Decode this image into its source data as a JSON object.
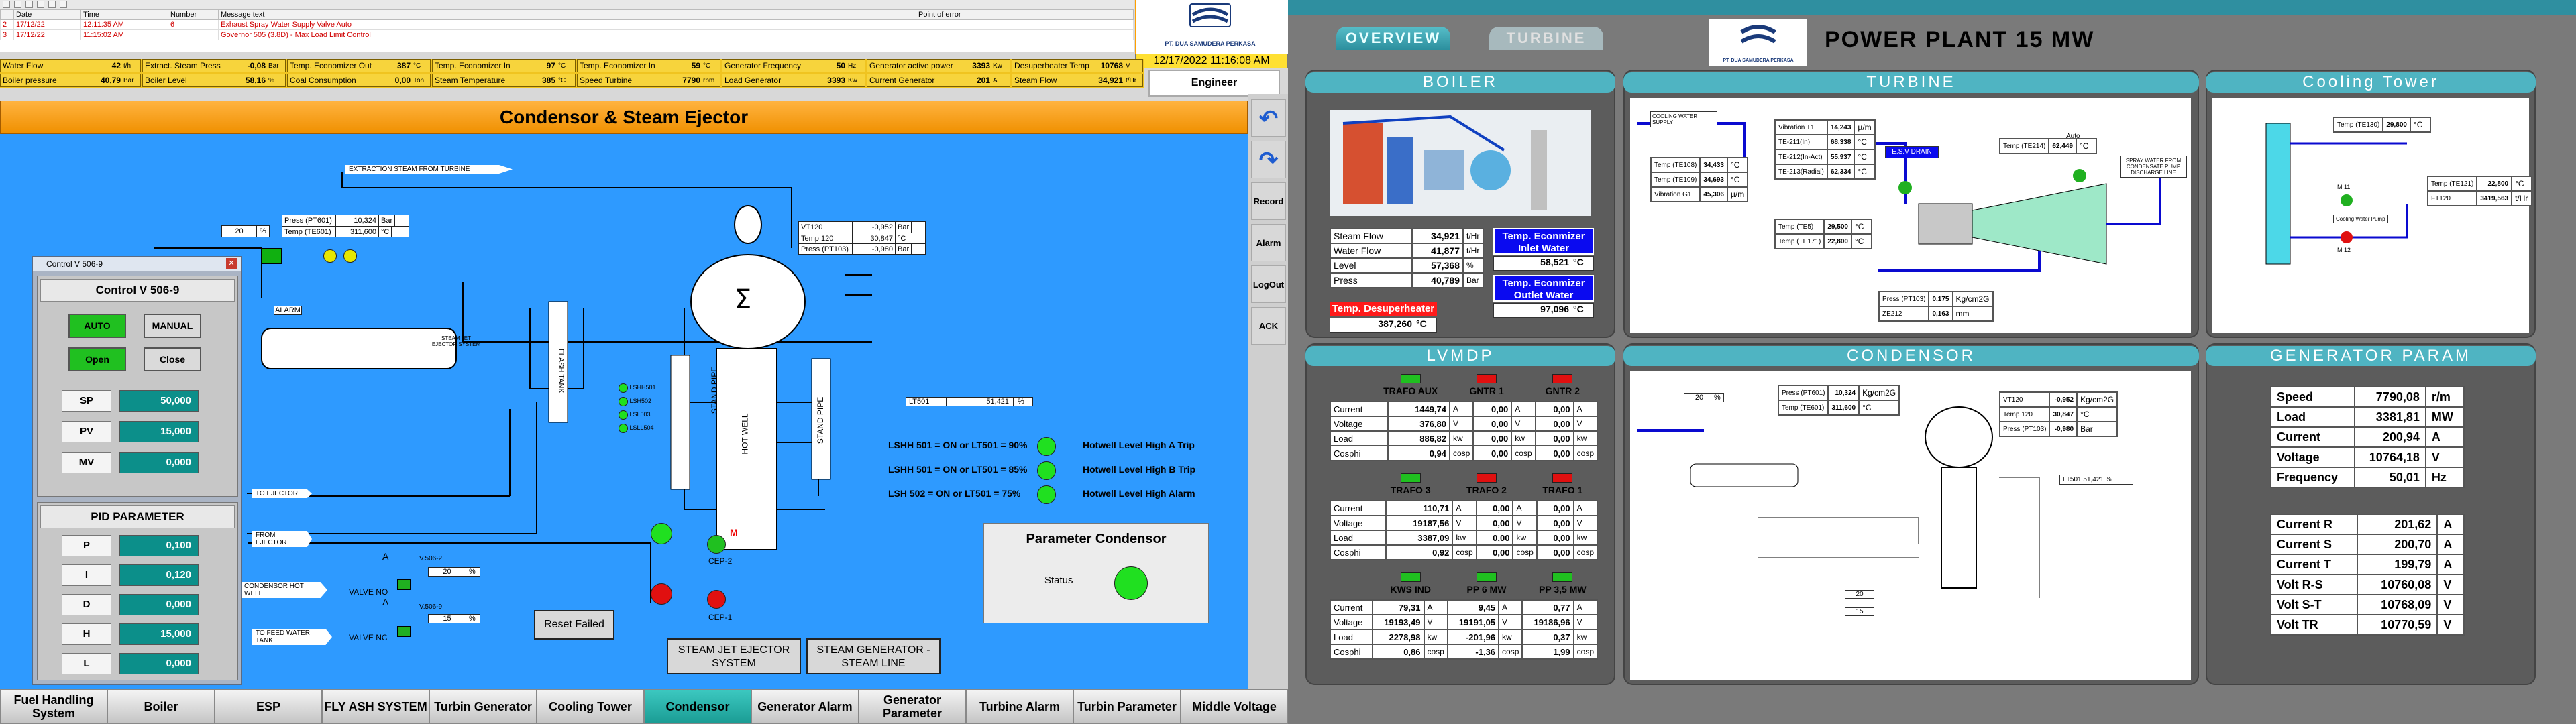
{
  "alarms": {
    "headers": [
      "Date",
      "Time",
      "Number",
      "Message text",
      "Point of error"
    ],
    "rows": [
      {
        "idx": "2",
        "date": "17/12/22",
        "time": "12:11:35 AM",
        "number": "6",
        "message": "Exhaust Spray Water Supply Valve Auto"
      },
      {
        "idx": "3",
        "date": "17/12/22",
        "time": "11:15:02 AM",
        "number": "",
        "message": "Governor 505 (3.8D) - Max Load Limit Control"
      }
    ]
  },
  "header": {
    "company": "PT. DUA SAMUDERA PERKASA",
    "datetime": "12/17/2022 11:16:08 AM",
    "user": "Engineer"
  },
  "status": [
    {
      "label": "Water Flow",
      "value": "42",
      "unit": "t/h"
    },
    {
      "label": "Extract. Steam Press",
      "value": "-0,08",
      "unit": "Bar"
    },
    {
      "label": "Temp. Economizer Out",
      "value": "387",
      "unit": "°C"
    },
    {
      "label": "Temp. Economizer In",
      "value": "97",
      "unit": "°C"
    },
    {
      "label": "Temp. Economizer In",
      "value": "59",
      "unit": "°C"
    },
    {
      "label": "Generator Frequency",
      "value": "50",
      "unit": "Hz"
    },
    {
      "label": "Generator active power",
      "value": "3393",
      "unit": "Kw"
    },
    {
      "label": "Desuperheater Temp",
      "value": "10768",
      "unit": "V"
    },
    {
      "label": "Boiler pressure",
      "value": "40,79",
      "unit": "Bar"
    },
    {
      "label": "Boiler Level",
      "value": "58,16",
      "unit": "%"
    },
    {
      "label": "Coal Consumption",
      "value": "0,00",
      "unit": "Ton"
    },
    {
      "label": "Steam Temperature",
      "value": "385",
      "unit": "°C"
    },
    {
      "label": "Speed Turbine",
      "value": "7790",
      "unit": "rpm"
    },
    {
      "label": "Load Generator",
      "value": "3393",
      "unit": "Kw"
    },
    {
      "label": "Current Generator",
      "value": "201",
      "unit": "A"
    },
    {
      "label": "Voltage Generator",
      "value": "10768",
      "unit": "V"
    },
    {
      "label": "Steam Flow",
      "value": "34,921",
      "unit": "t/Hr"
    }
  ],
  "page_title": "Condensor & Steam Ejector",
  "sidebar": [
    "Record",
    "Alarm",
    "LogOut",
    "ACK"
  ],
  "nav": [
    "Fuel Handling System",
    "Boiler",
    "ESP",
    "FLY ASH SYSTEM",
    "Turbin Generator",
    "Cooling Tower",
    "Condensor",
    "Generator Alarm",
    "Generator Parameter",
    "Turbine Alarm",
    "Turbin Parameter",
    "Middle Voltage"
  ],
  "nav_active": "Condensor",
  "control": {
    "window_title": "Control V 506-9",
    "heading": "Control V 506-9",
    "auto": "AUTO",
    "manual": "MANUAL",
    "open": "Open",
    "close": "Close",
    "values": [
      {
        "k": "SP",
        "v": "50,000"
      },
      {
        "k": "PV",
        "v": "15,000"
      },
      {
        "k": "MV",
        "v": "0,000"
      }
    ],
    "pid_heading": "PID PARAMETER",
    "pid": [
      {
        "k": "P",
        "v": "0,100"
      },
      {
        "k": "I",
        "v": "0,120"
      },
      {
        "k": "D",
        "v": "0,000"
      },
      {
        "k": "H",
        "v": "15,000"
      },
      {
        "k": "L",
        "v": "0,000"
      }
    ]
  },
  "diagram": {
    "extraction": "EXTRACTION STEAM FROM TURBINE",
    "valve_pct": "20",
    "pct": "%",
    "ejector_table": [
      [
        "Press (PT601)",
        "10,324",
        "Bar"
      ],
      [
        "Temp (TE601)",
        "311,600",
        "°C"
      ]
    ],
    "alarm": "ALARM",
    "ejector_label": "STEAM JET EJECTOR SYSTEM",
    "flash_tank": "FLASH TANK",
    "stand_pipe": "STAND PIPE",
    "hot_well": "HOT WELL",
    "vt_table": [
      [
        "VT120",
        "-0,952",
        "Bar"
      ],
      [
        "Temp 120",
        "30,847",
        "°C"
      ],
      [
        "Press (PT103)",
        "-0,980",
        "Bar"
      ]
    ],
    "level_leds": [
      "LSHH501",
      "LSH502",
      "LSL503",
      "LSLL504"
    ],
    "lt501": {
      "label": "LT501",
      "value": "51,421",
      "unit": "%"
    },
    "rules": [
      {
        "cond": "LSHH 501 = ON or LT501 = 90%",
        "text": "Hotwell Level High A Trip"
      },
      {
        "cond": "LSHH 501 = ON or LT501 = 85%",
        "text": "Hotwell Level High B Trip"
      },
      {
        "cond": "LSH 502   = ON or LT501 = 75%",
        "text": "Hotwell Level High Alarm"
      }
    ],
    "to_ejector": "TO EJECTOR",
    "from_ejector": "FROM EJECTOR",
    "cond_hot_well": "CONDENSOR HOT WELL",
    "feed_water": "TO FEED WATER TANK",
    "valve_no": {
      "name": "VALVE NO",
      "id": "V.506-2",
      "value": "20"
    },
    "valve_nc": {
      "name": "VALVE NC",
      "id": "V.506-9",
      "value": "15"
    },
    "cep2": "CEP-2",
    "cep1": "CEP-1",
    "m": "M",
    "a": "A",
    "reset": "Reset Failed",
    "param_title": "Parameter Condensor",
    "status": "Status",
    "btn_ejector": "STEAM JET EJECTOR SYSTEM",
    "btn_generator": "STEAM GENERATOR - STEAM LINE"
  },
  "right": {
    "tabs": [
      "OVERVIEW",
      "TURBINE"
    ],
    "title": "POWER PLANT 15 MW",
    "company": "PT. DUA SAMUDERA PERKASA",
    "boiler": {
      "title": "BOILER",
      "rows": [
        [
          "Steam Flow",
          "34,921",
          "t/Hr"
        ],
        [
          "Water Flow",
          "41,877",
          "t/Hr"
        ],
        [
          "Level",
          "57,368",
          "%"
        ],
        [
          "Press",
          "40,789",
          "Bar"
        ]
      ],
      "eco_in_label": "Temp. Econmizer Inlet Water",
      "eco_in": "58,521",
      "eco_out_label": "Temp. Econmizer Outlet Water",
      "eco_out": "97,096",
      "desup_label": "Temp. Desuperheater",
      "desup": "387,260",
      "degc": "°C"
    },
    "lvmdp": {
      "title": "LVMDP",
      "groups": [
        {
          "heads": [
            "TRAFO AUX",
            "GNTR  1",
            "GNTR  2"
          ],
          "leds": [
            "#20c020",
            "#e01010",
            "#e01010"
          ],
          "rows": [
            [
              "Current",
              "1449,74",
              "A",
              "0,00",
              "A",
              "0,00",
              "A"
            ],
            [
              "Voltage",
              "376,80",
              "V",
              "0,00",
              "V",
              "0,00",
              "V"
            ],
            [
              "Load",
              "886,82",
              "kw",
              "0,00",
              "kw",
              "0,00",
              "kw"
            ],
            [
              "Cosphi",
              "0,94",
              "cosp",
              "0,00",
              "cosp",
              "0,00",
              "cosp"
            ]
          ]
        },
        {
          "heads": [
            "TRAFO 3",
            "TRAFO 2",
            "TRAFO 1"
          ],
          "leds": [
            "#20c020",
            "#e01010",
            "#e01010"
          ],
          "rows": [
            [
              "Current",
              "110,71",
              "A",
              "0,00",
              "A",
              "0,00",
              "A"
            ],
            [
              "Voltage",
              "19187,56",
              "V",
              "0,00",
              "V",
              "0,00",
              "V"
            ],
            [
              "Load",
              "3387,09",
              "kw",
              "0,00",
              "kw",
              "0,00",
              "kw"
            ],
            [
              "Cosphi",
              "0,92",
              "cosp",
              "0,00",
              "cosp",
              "0,00",
              "cosp"
            ]
          ]
        },
        {
          "heads": [
            "KWS IND",
            "PP 6 MW",
            "PP 3,5 MW"
          ],
          "leds": [
            "#20c020",
            "#20c020",
            "#20c020"
          ],
          "rows": [
            [
              "Current",
              "79,31",
              "A",
              "9,45",
              "A",
              "0,77",
              "A"
            ],
            [
              "Voltage",
              "19193,49",
              "V",
              "19191,05",
              "V",
              "19186,96",
              "V"
            ],
            [
              "Load",
              "2278,98",
              "kw",
              "-201,96",
              "kw",
              "0,37",
              "kw"
            ],
            [
              "Cosphi",
              "0,86",
              "cosp",
              "-1,36",
              "cosp",
              "1,99",
              "cosp"
            ]
          ]
        }
      ]
    },
    "turbine": {
      "title": "TURBINE",
      "vib": [
        [
          "Vibration T1",
          "14,243",
          "µ/m"
        ],
        [
          "TE-211(In)",
          "68,338",
          "°C"
        ],
        [
          "TE-212(In-Act)",
          "55,937",
          "°C"
        ],
        [
          "TE-213(Radial)",
          "62,334",
          "°C"
        ]
      ],
      "temps_l": [
        [
          "Temp (TE108)",
          "34,433",
          "°C"
        ],
        [
          "Temp (TE109)",
          "34,693",
          "°C"
        ],
        [
          "Vibration G1",
          "45,306",
          "µ/m"
        ]
      ],
      "te5": [
        [
          "Temp (TE5)",
          "29,500",
          "°C"
        ],
        [
          "Temp (TE171)",
          "22,800",
          "°C"
        ]
      ],
      "te214": [
        "Temp (TE214)",
        "62,449",
        "°C"
      ],
      "press": [
        "Press (PT103)",
        "0,175",
        "Kg/cm2G"
      ],
      "ze": [
        "ZE212",
        "0,163",
        "mm"
      ],
      "esv": "E.S.V DRAIN",
      "auto": "Auto",
      "cooling_water": "COOLING WATER SUPPLY",
      "spray": "SPRAY WATER FROM CONDENSATE PUMP DISCHARGE LINE"
    },
    "cooling": {
      "title": "Cooling Tower",
      "te130": [
        "Temp (TE130)",
        "29,800",
        "°C"
      ],
      "te121": [
        "Temp (TE121)",
        "22,800",
        "°C"
      ],
      "ft120": [
        "FT120",
        "3419,563",
        "t/Hr"
      ],
      "pump": "Cooling Water Pump",
      "m11": "M 11",
      "m12": "M 12"
    },
    "condensor": {
      "title": "CONDENSOR",
      "pct": "20",
      "ej": [
        [
          "Press (PT601)",
          "10,324",
          "Kg/cm2G"
        ],
        [
          "Temp (TE601)",
          "311,600",
          "°C"
        ]
      ],
      "vt": [
        [
          "VT120",
          "-0,952",
          "Kg/cm2G"
        ],
        [
          "Temp 120",
          "30,847",
          "°C"
        ],
        [
          "Press (PT103)",
          "-0,980",
          "Bar"
        ]
      ],
      "lt501": "LT501  51,421 %",
      "rules": [
        "LSHH 501 = ON or LT501 = 90%",
        "LSHH 501 = ON or LT501 = 85%",
        "LSH 502 = ON or LT501 = 75%"
      ],
      "valve_no": "20",
      "valve_nc": "15"
    },
    "gen": {
      "title": "GENERATOR PARAM",
      "a": [
        [
          "Speed",
          "7790,08",
          "r/m"
        ],
        [
          "Load",
          "3381,81",
          "MW"
        ],
        [
          "Current",
          "200,94",
          "A"
        ],
        [
          "Voltage",
          "10764,18",
          "V"
        ],
        [
          "Frequency",
          "50,01",
          "Hz"
        ]
      ],
      "b": [
        [
          "Current R",
          "201,62",
          "A"
        ],
        [
          "Current S",
          "200,70",
          "A"
        ],
        [
          "Current T",
          "199,79",
          "A"
        ],
        [
          "Volt R-S",
          "10760,08",
          "V"
        ],
        [
          "Volt S-T",
          "10768,09",
          "V"
        ],
        [
          "Volt TR",
          "10770,59",
          "V"
        ]
      ]
    }
  }
}
